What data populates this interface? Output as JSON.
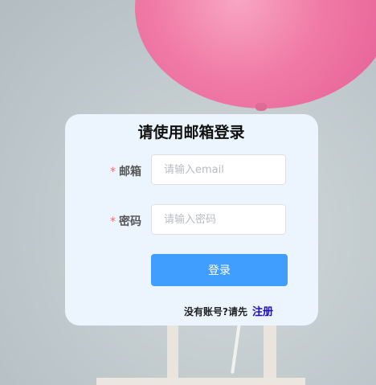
{
  "login": {
    "title": "请使用邮箱登录",
    "required_mark": "*",
    "email_label": "邮箱",
    "email_placeholder": "请输入email",
    "email_value": "",
    "password_label": "密码",
    "password_placeholder": "请输入密码",
    "password_value": "",
    "login_button": "登录",
    "register_prompt": "没有账号?请先",
    "register_link": "注册"
  },
  "colors": {
    "card_background": "#ecf5fe",
    "primary_button": "#409eff",
    "required_mark": "#f56c6c",
    "register_link": "#1a0dcc"
  }
}
